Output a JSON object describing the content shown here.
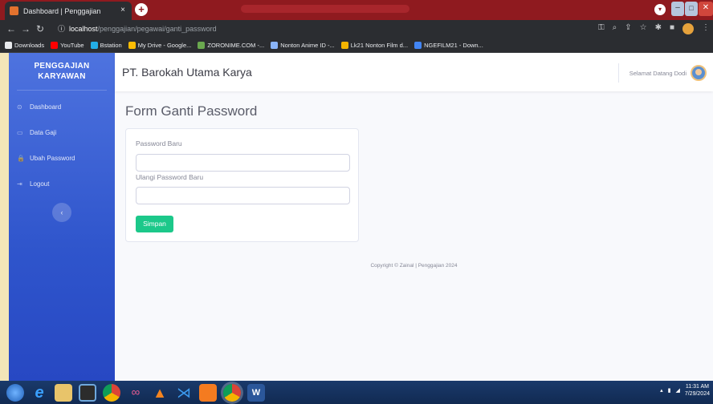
{
  "browser": {
    "tab_title": "Dashboard | Penggajian",
    "tab_close": "×",
    "new_tab": "+",
    "url_host": "localhost",
    "url_path": "/penggajian/pegawai/ganti_password",
    "bookmarks": [
      {
        "label": "Downloads",
        "color": "#e8eaed"
      },
      {
        "label": "YouTube",
        "color": "#ff0000"
      },
      {
        "label": "Bstation",
        "color": "#23ade5"
      },
      {
        "label": "My Drive - Google...",
        "color": "#fbbc04"
      },
      {
        "label": "ZORONIME.COM -...",
        "color": "#6aa84f"
      },
      {
        "label": "Nonton Anime ID -...",
        "color": "#8ab4f8"
      },
      {
        "label": "Lk21 Nonton Film d...",
        "color": "#f4b400"
      },
      {
        "label": "NGEFILM21 - Down...",
        "color": "#4285f4"
      }
    ]
  },
  "sidebar": {
    "brand_line1": "PENGGAJIAN",
    "brand_line2": "KARYAWAN",
    "items": [
      {
        "label": "Dashboard",
        "icon": "⊙"
      },
      {
        "label": "Data Gaji",
        "icon": "▭"
      },
      {
        "label": "Ubah Password",
        "icon": "🔒"
      },
      {
        "label": "Logout",
        "icon": "⇥"
      }
    ],
    "toggle": "‹"
  },
  "topbar": {
    "company": "PT. Barokah Utama Karya",
    "greeting": "Selamat Datang Dodi"
  },
  "main": {
    "page_title": "Form Ganti Password",
    "field1_label": "Password Baru",
    "field1_value": "",
    "field2_label": "Ulangi Password Baru",
    "field2_value": "",
    "save_label": "Simpan",
    "footer": "Copyright © Zainal | Penggajian 2024"
  },
  "taskbar": {
    "time": "11:31 AM",
    "date": "7/29/2024"
  },
  "colors": {
    "primary": "#4e73df",
    "success": "#1cc88a"
  }
}
